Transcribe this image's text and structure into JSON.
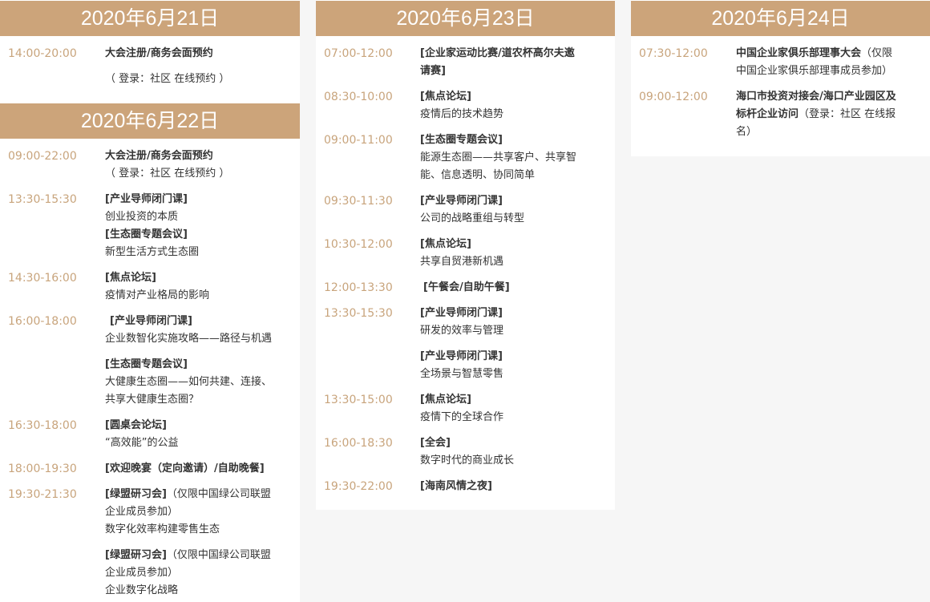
{
  "colors": {
    "header_bg": "#cca47a",
    "time_text": "#c8a47c",
    "body_text": "#333333",
    "page_bg": "#f6f6f6"
  },
  "day1": {
    "date": "2020年6月21日",
    "items": [
      {
        "time": "14:00-20:00",
        "l1": "大会注册/商务会面预约",
        "l2": "（ 登录：社区 在线预约 ）"
      }
    ]
  },
  "day2": {
    "date": "2020年6月22日",
    "items": [
      {
        "time": "09:00-22:00",
        "l1": "大会注册/商务会面预约",
        "l2": "（ 登录：社区 在线预约 ）"
      },
      {
        "time": "13:30-15:30",
        "l1": "[产业导师闭门课]",
        "l2": "创业投资的本质",
        "l3": "[生态圈专题会议]",
        "l4": "新型生活方式生态圈"
      },
      {
        "time": "14:30-16:00",
        "l1": "[焦点论坛]",
        "l2": "疫情对产业格局的影响"
      },
      {
        "time": "16:00-18:00",
        "l1": "[产业导师闭门课]",
        "l2": "企业数智化实施攻略——路径与机遇"
      },
      {
        "l1": "[生态圈专题会议]",
        "l2": "大健康生态圈——如何共建、连接、",
        "l3": "共享大健康生态圈？"
      },
      {
        "time": "16:30-18:00",
        "l1": "[圆桌会论坛]",
        "l2": "“高效能”的公益"
      },
      {
        "time": "18:00-19:30",
        "l1": "[欢迎晚宴（定向邀请）/自助晚餐]"
      },
      {
        "time": "19:30-21:30",
        "l1b": "[绿盟研习会]",
        "l1n": "（仅限中国绿公司联盟",
        "l2": "企业成员参加）",
        "l3": "数字化效率构建零售生态"
      },
      {
        "l1b": "[绿盟研习会]",
        "l1n": "（仅限中国绿公司联盟",
        "l2": "企业成员参加）",
        "l3": "企业数字化战略"
      }
    ]
  },
  "day3": {
    "date": "2020年6月23日",
    "items": [
      {
        "time": "07:00-12:00",
        "l1": "[企业家运动比赛/道农杯高尔夫邀",
        "l2": "请赛]"
      },
      {
        "time": "08:30-10:00",
        "l1": "[焦点论坛]",
        "l2": "疫情后的技术趋势"
      },
      {
        "time": "09:00-11:00",
        "l1": "[生态圈专题会议]",
        "l2": "能源生态圈——共享客户、共享智",
        "l3": "能、信息透明、协同简单"
      },
      {
        "time": "09:30-11:30",
        "l1": "[产业导师闭门课]",
        "l2": "公司的战略重组与转型"
      },
      {
        "time": "10:30-12:00",
        "l1": "[焦点论坛]",
        "l2": "共享自贸港新机遇"
      },
      {
        "time": "12:00-13:30",
        "l1": "[午餐会/自助午餐]"
      },
      {
        "time": "13:30-15:30",
        "l1": "[产业导师闭门课]",
        "l2": "研发的效率与管理"
      },
      {
        "l1": "[产业导师闭门课]",
        "l2": "全场景与智慧零售"
      },
      {
        "time": "13:30-15:00",
        "l1": "[焦点论坛]",
        "l2": "疫情下的全球合作"
      },
      {
        "time": "16:00-18:30",
        "l1": "[全会]",
        "l2": "数字时代的商业成长"
      },
      {
        "time": "19:30-22:00",
        "l1": "[海南风情之夜]"
      }
    ]
  },
  "day4": {
    "date": "2020年6月24日",
    "items": [
      {
        "time": "07:30-12:00",
        "l1b": "中国企业家俱乐部理事大会",
        "l1n": "（仅限",
        "l2": "中国企业家俱乐部理事成员参加）"
      },
      {
        "time": "09:00-12:00",
        "l1": "海口市投资对接会/海口产业园区及",
        "l2b": "标杆企业访问",
        "l2n": "（登录：社区 在线报",
        "l3": "名）"
      }
    ]
  }
}
